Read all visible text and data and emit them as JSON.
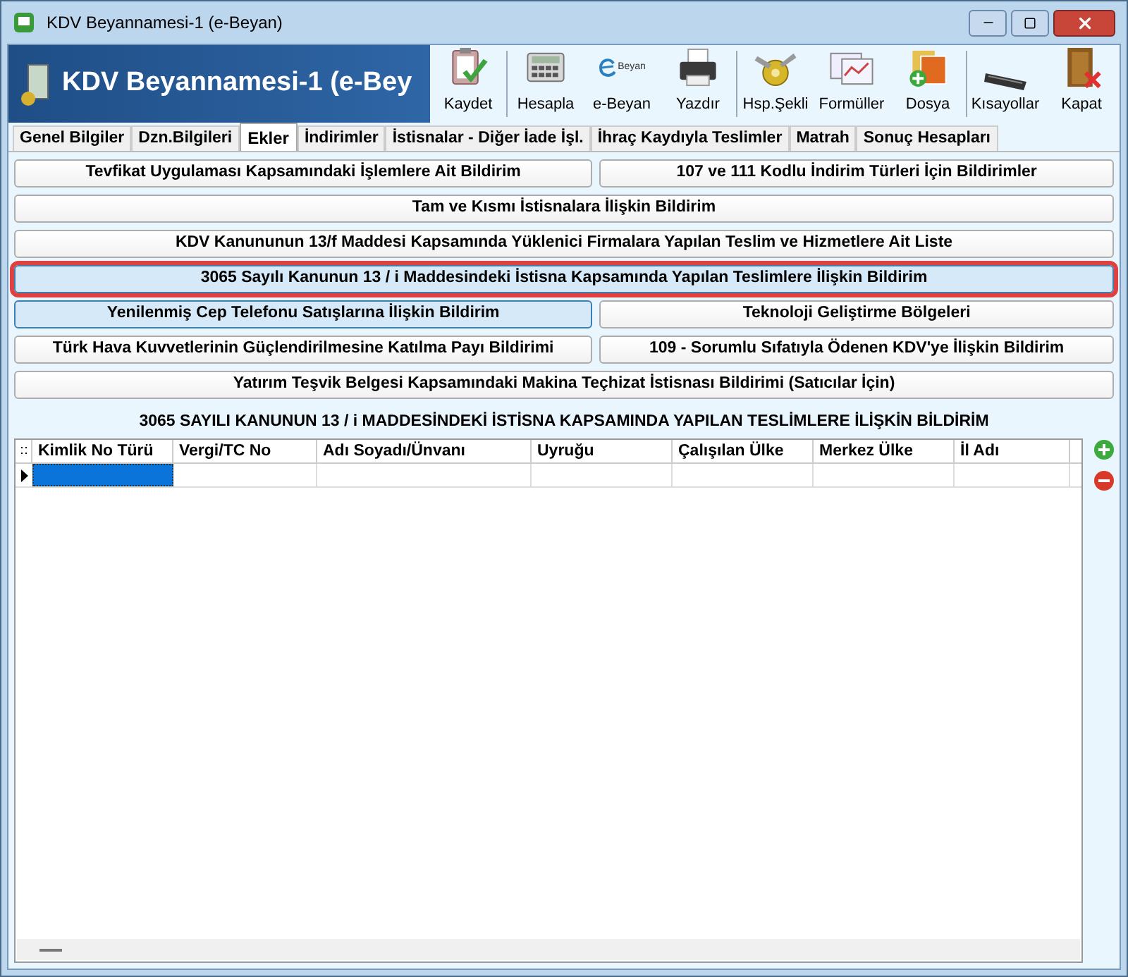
{
  "window": {
    "title": "KDV Beyannamesi-1 (e-Beyan)"
  },
  "banner": {
    "title": "KDV Beyannamesi-1 (e-Bey"
  },
  "toolbar": [
    {
      "kind": "save",
      "label": "Kaydet"
    },
    {
      "kind": "calc",
      "label": "Hesapla"
    },
    {
      "kind": "ebeyan",
      "label": "e-Beyan",
      "logo_text": "Beyan"
    },
    {
      "kind": "print",
      "label": "Yazdır"
    },
    {
      "kind": "gear",
      "label": "Hsp.Şekli"
    },
    {
      "kind": "formula",
      "label": "Formüller"
    },
    {
      "kind": "file",
      "label": "Dosya"
    },
    {
      "kind": "keyboard",
      "label": "Kısayollar"
    },
    {
      "kind": "close",
      "label": "Kapat"
    }
  ],
  "tabs": [
    {
      "label": "Genel Bilgiler",
      "selected": false
    },
    {
      "label": "Dzn.Bilgileri",
      "selected": false
    },
    {
      "label": "Ekler",
      "selected": true
    },
    {
      "label": "İndirimler",
      "selected": false
    },
    {
      "label": "İstisnalar - Diğer İade İşl.",
      "selected": false
    },
    {
      "label": "İhraç Kaydıyla Teslimler",
      "selected": false
    },
    {
      "label": "Matrah",
      "selected": false
    },
    {
      "label": "Sonuç Hesapları",
      "selected": false
    }
  ],
  "form_buttons": [
    [
      {
        "label": "Tevfikat Uygulaması Kapsamındaki İşlemlere Ait Bildirim",
        "selected": false,
        "highlighted": false
      },
      {
        "label": "107 ve 111 Kodlu İndirim Türleri İçin Bildirimler",
        "selected": false,
        "highlighted": false
      }
    ],
    [
      {
        "label": "Tam ve Kısmı İstisnalara İlişkin Bildirim",
        "selected": false,
        "highlighted": false
      }
    ],
    [
      {
        "label": "KDV Kanununun 13/f Maddesi Kapsamında Yüklenici Firmalara Yapılan Teslim ve Hizmetlere Ait Liste",
        "selected": false,
        "highlighted": false
      }
    ],
    [
      {
        "label": "3065 Sayılı Kanunun  13 / i  Maddesindeki İstisna Kapsamında Yapılan Teslimlere İlişkin Bildirim",
        "selected": true,
        "highlighted": true
      }
    ],
    [
      {
        "label": "Yenilenmiş Cep Telefonu Satışlarına İlişkin Bildirim",
        "selected": false,
        "highlighted": true
      },
      {
        "label": "Teknoloji Geliştirme Bölgeleri",
        "selected": false,
        "highlighted": false
      }
    ],
    [
      {
        "label": "Türk Hava Kuvvetlerinin Güçlendirilmesine Katılma Payı Bildirimi",
        "selected": false,
        "highlighted": false
      },
      {
        "label": "109 - Sorumlu Sıfatıyla Ödenen KDV'ye İlişkin Bildirim",
        "selected": false,
        "highlighted": false
      }
    ],
    [
      {
        "label": "Yatırım Teşvik Belgesi Kapsamındaki Makina Teçhizat İstisnası Bildirimi (Satıcılar İçin)",
        "selected": false,
        "highlighted": false
      }
    ]
  ],
  "grid": {
    "title": "3065 SAYILI KANUNUN  13 / i  MADDESİNDEKİ İSTİSNA KAPSAMINDA YAPILAN TESLİMLERE İLİŞKİN BİLDİRİM",
    "columns": [
      "Kimlik No Türü",
      "Vergi/TC No",
      "Adı Soyadı/Ünvanı",
      "Uyruğu",
      "Çalışılan Ülke",
      "Merkez Ülke",
      "İl Adı"
    ],
    "rows": [
      {
        "current": true,
        "cells": [
          "",
          "",
          "",
          "",
          "",
          "",
          ""
        ]
      }
    ]
  }
}
